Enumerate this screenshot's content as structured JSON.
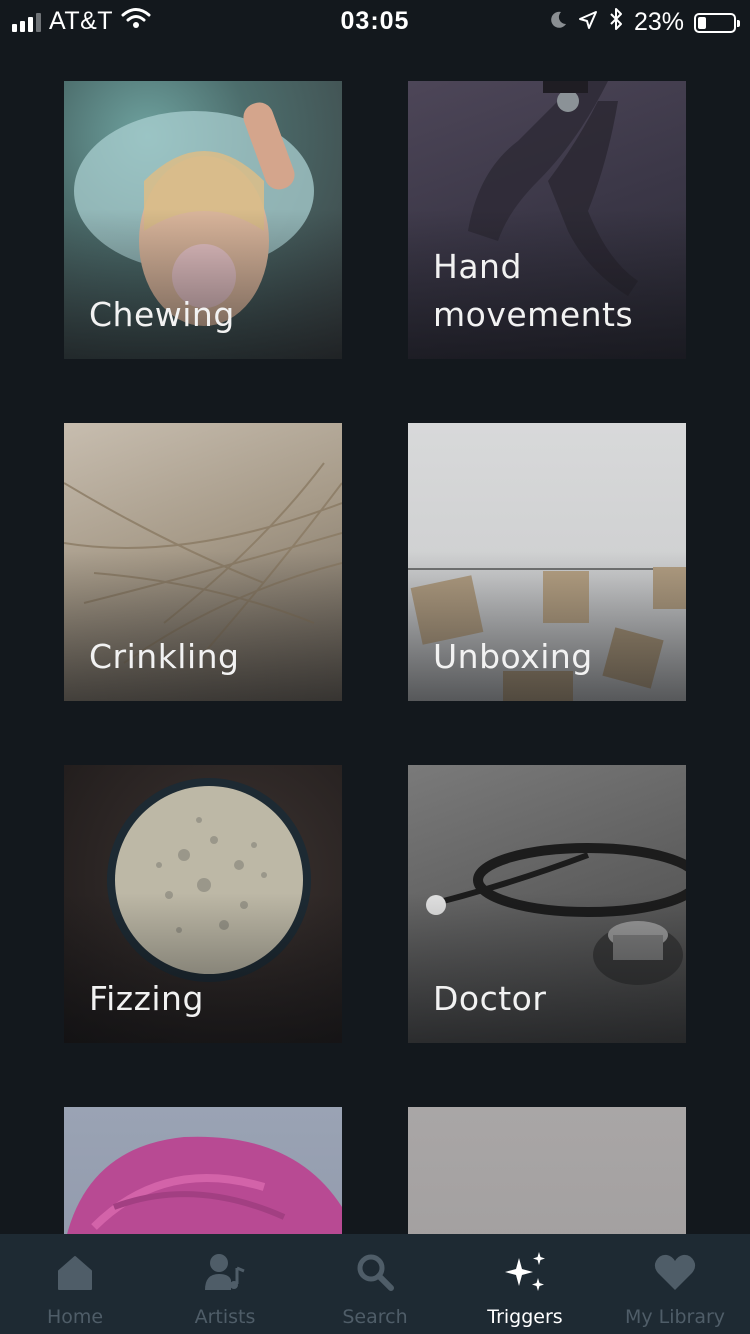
{
  "status_bar": {
    "carrier": "AT&T",
    "time": "03:05",
    "battery_percent": "23%",
    "battery_level": 0.23,
    "signal_bars_filled": 3,
    "signal_bars_total": 4,
    "icons": [
      "signal-icon",
      "wifi-icon",
      "moon-icon",
      "location-arrow-icon",
      "bluetooth-icon",
      "battery-icon"
    ]
  },
  "triggers": [
    {
      "label": "Chewing"
    },
    {
      "label": "Hand movements"
    },
    {
      "label": "Crinkling"
    },
    {
      "label": "Unboxing"
    },
    {
      "label": "Fizzing"
    },
    {
      "label": "Doctor"
    },
    {
      "label": ""
    },
    {
      "label": ""
    }
  ],
  "tab_bar": {
    "active": "Triggers",
    "tabs": [
      {
        "label": "Home",
        "icon": "home-icon"
      },
      {
        "label": "Artists",
        "icon": "artist-icon"
      },
      {
        "label": "Search",
        "icon": "search-icon"
      },
      {
        "label": "Triggers",
        "icon": "sparkles-icon"
      },
      {
        "label": "My Library",
        "icon": "heart-icon"
      }
    ]
  },
  "colors": {
    "background": "#13181d",
    "tab_bar": "#1e2a33",
    "tab_inactive": "#4f5d68",
    "tab_active": "#ffffff"
  }
}
